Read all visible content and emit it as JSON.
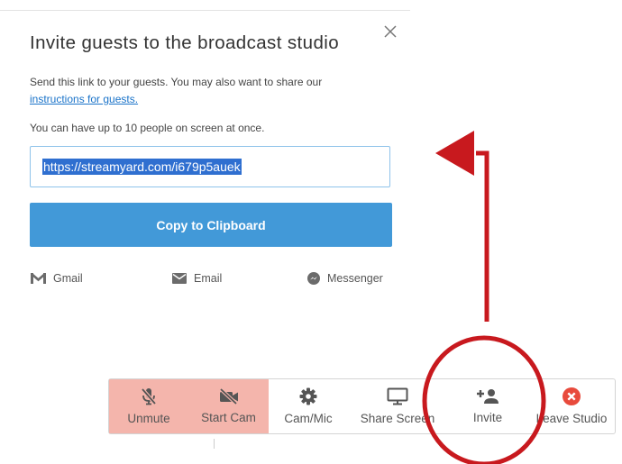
{
  "dialog": {
    "title": "Invite guests to the broadcast studio",
    "description": "Send this link to your guests. You may also want to share our",
    "instructions_link": "instructions for guests.",
    "limit_text": "You can have up to 10 people on screen at once.",
    "invite_link": "https://streamyard.com/i679p5auek",
    "copy_button": "Copy to Clipboard",
    "share_options": [
      {
        "label": "Gmail",
        "icon": "gmail-icon"
      },
      {
        "label": "Email",
        "icon": "envelope-icon"
      },
      {
        "label": "Messenger",
        "icon": "messenger-icon"
      }
    ]
  },
  "toolbar": {
    "buttons": [
      {
        "label": "Unmute",
        "icon": "mic-off-icon",
        "state": "off"
      },
      {
        "label": "Start Cam",
        "icon": "camera-off-icon",
        "state": "off"
      },
      {
        "label": "Cam/Mic",
        "icon": "gear-icon"
      },
      {
        "label": "Share Screen",
        "icon": "monitor-icon"
      },
      {
        "label": "Invite",
        "icon": "add-person-icon"
      },
      {
        "label": "Leave Studio",
        "icon": "close-circle-icon"
      }
    ]
  },
  "colors": {
    "primary": "#4299d8",
    "link": "#1a73c9",
    "selection": "#2f6fd0",
    "danger_bg": "#f4b5ac",
    "leave": "#e84a3c",
    "annotation": "#c8191e"
  }
}
